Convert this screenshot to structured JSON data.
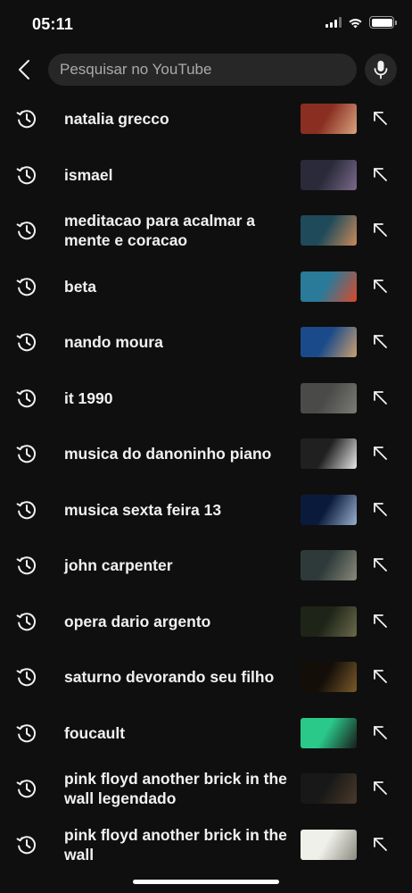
{
  "status_bar": {
    "time": "05:11",
    "icons": [
      "cellular-signal-icon",
      "wifi-icon",
      "battery-icon"
    ]
  },
  "search": {
    "placeholder": "Pesquisar no YouTube",
    "value": "",
    "back_icon": "chevron-left-icon",
    "mic_icon": "microphone-icon"
  },
  "history": {
    "row_icon": "history-clock-icon",
    "fill_icon": "arrow-up-left-icon",
    "items": [
      {
        "query": "natalia grecco",
        "thumb_colors": [
          "#8a2e22",
          "#d9a47e"
        ]
      },
      {
        "query": "ismael",
        "thumb_colors": [
          "#2a2a3a",
          "#7a6a8a"
        ]
      },
      {
        "query": "meditacao para acalmar a mente e coracao",
        "thumb_colors": [
          "#1f4a5a",
          "#c98a5a"
        ]
      },
      {
        "query": "beta",
        "thumb_colors": [
          "#2a7a9a",
          "#d94a2a"
        ]
      },
      {
        "query": "nando moura",
        "thumb_colors": [
          "#1a4a8a",
          "#caa070"
        ]
      },
      {
        "query": "it 1990",
        "thumb_colors": [
          "#4a4a48",
          "#7a7a76"
        ]
      },
      {
        "query": "musica do danoninho piano",
        "thumb_colors": [
          "#202020",
          "#e8e8e8"
        ]
      },
      {
        "query": "musica sexta feira 13",
        "thumb_colors": [
          "#0a1a3a",
          "#9ab0d0"
        ]
      },
      {
        "query": "john carpenter",
        "thumb_colors": [
          "#2e3a3a",
          "#8a8a7a"
        ]
      },
      {
        "query": "opera dario argento",
        "thumb_colors": [
          "#1e2418",
          "#6a6a4a"
        ]
      },
      {
        "query": "saturno devorando seu filho",
        "thumb_colors": [
          "#140e08",
          "#7a5a2a"
        ]
      },
      {
        "query": "foucault",
        "thumb_colors": [
          "#2ac98a",
          "#1a1a1a"
        ]
      },
      {
        "query": "pink floyd another brick in the wall legendado",
        "thumb_colors": [
          "#181818",
          "#4a3a2a"
        ]
      },
      {
        "query": "pink floyd another brick in the wall",
        "thumb_colors": [
          "#f0f0ea",
          "#8a8a80"
        ]
      }
    ]
  }
}
